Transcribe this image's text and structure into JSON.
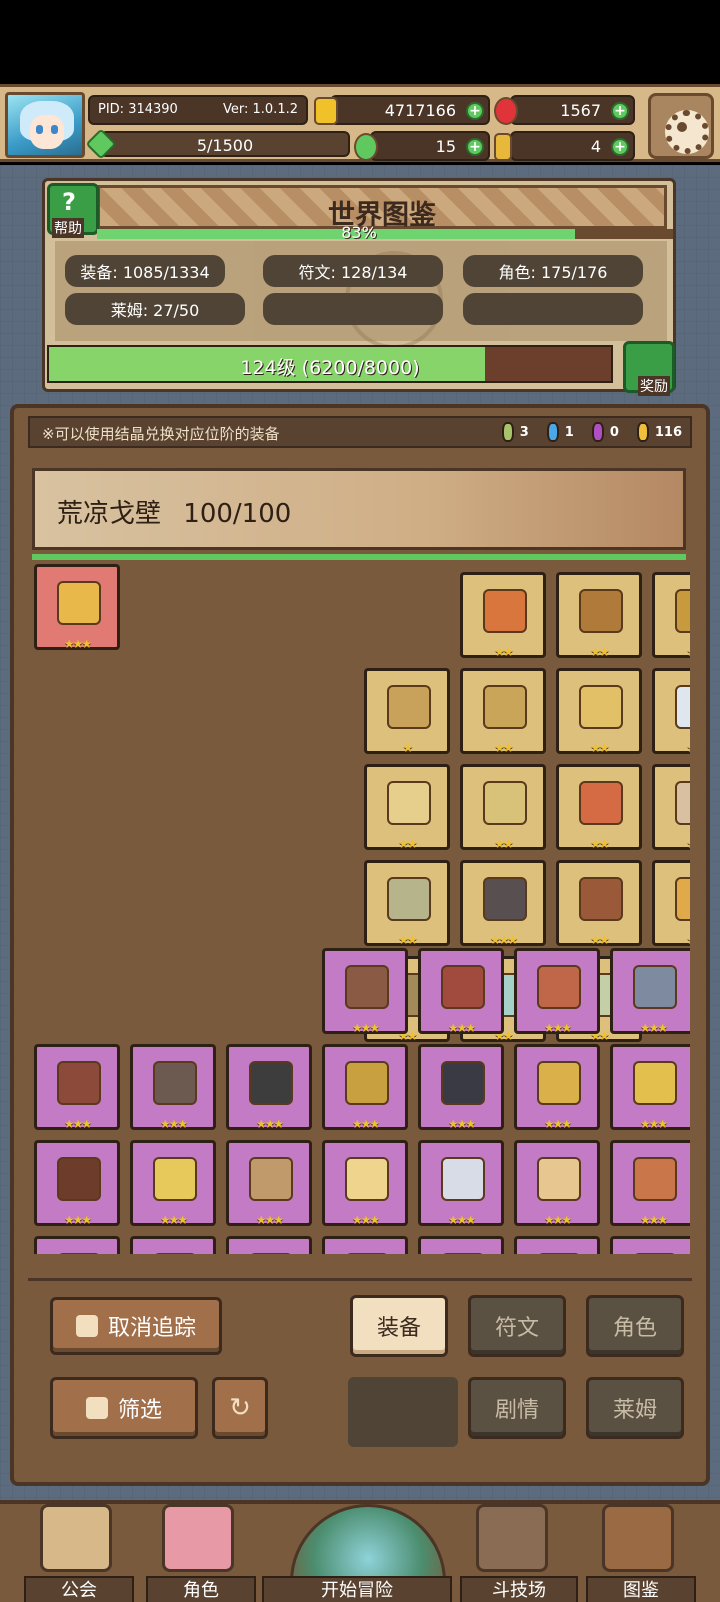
{
  "hud": {
    "pid": "PID: 314390",
    "version": "Ver: 1.0.1.2",
    "gold": "4717166",
    "gems": "1567",
    "xp": "5/1500",
    "clover": "15",
    "keys": "4"
  },
  "worldbook": {
    "title": "世界图鉴",
    "help_label": "帮助",
    "percent": "83%",
    "stats": [
      "装备: 1085/1334",
      "符文: 128/134",
      "角色: 175/176",
      "莱姆: 27/50"
    ],
    "level_text": "124级 (6200/8000)",
    "reward_label": "奖励"
  },
  "equipment": {
    "notice": "※可以使用结晶兑换对应位阶的装备",
    "crystals": [
      {
        "count": "3",
        "color": "#a8c36a"
      },
      {
        "count": "1",
        "color": "#4aa7e8"
      },
      {
        "count": "0",
        "color": "#b04fc1"
      },
      {
        "count": "116",
        "color": "#f0c03a"
      }
    ],
    "area_name": "荒凉戈壁",
    "area_progress": "100/100",
    "items": [
      {
        "bg": "red",
        "stars": "★★★",
        "color": "#e9b84a"
      },
      {
        "bg": "gold",
        "stars": "★★",
        "color": "#d9763e"
      },
      {
        "bg": "gold",
        "stars": "★★",
        "color": "#b07a3a"
      },
      {
        "bg": "gold",
        "stars": "★★",
        "color": "#c79a3e"
      },
      {
        "bg": "gold",
        "stars": "★★",
        "color": "#a9793c"
      },
      {
        "bg": "gold",
        "stars": "★★",
        "color": "#d6a546"
      },
      {
        "bg": "gold",
        "stars": "★★",
        "color": "#c0623f"
      },
      {
        "bg": "gold",
        "stars": "★",
        "color": "#c8a25a"
      },
      {
        "bg": "gold",
        "stars": "★★",
        "color": "#c9a55a"
      },
      {
        "bg": "gold",
        "stars": "★★",
        "color": "#e2c067"
      },
      {
        "bg": "gold",
        "stars": "★★",
        "color": "#dfe6ee"
      },
      {
        "bg": "gold",
        "stars": "★★",
        "color": "#8fd3e6"
      },
      {
        "bg": "gold",
        "stars": "★★",
        "color": "#c98f52"
      },
      {
        "bg": "gold",
        "stars": "★★",
        "color": "#9aa06a"
      },
      {
        "bg": "gold",
        "stars": "★★",
        "color": "#e6cf8c"
      },
      {
        "bg": "gold",
        "stars": "★★",
        "color": "#d8c27a"
      },
      {
        "bg": "gold",
        "stars": "★★",
        "color": "#d56b45"
      },
      {
        "bg": "gold",
        "stars": "★★",
        "color": "#d8c0a0"
      },
      {
        "bg": "gold",
        "stars": "★★",
        "color": "#b8474a"
      },
      {
        "bg": "gold",
        "stars": "★★",
        "color": "#7c9c82"
      },
      {
        "bg": "gold",
        "stars": "★★",
        "color": "#4e5744"
      },
      {
        "bg": "gold",
        "stars": "★★",
        "color": "#b6b48a"
      },
      {
        "bg": "gold",
        "stars": "★★★",
        "color": "#585050"
      },
      {
        "bg": "gold",
        "stars": "★★",
        "color": "#9a5a3a"
      },
      {
        "bg": "gold",
        "stars": "★★",
        "color": "#e0a94a"
      },
      {
        "bg": "gold",
        "stars": "★★",
        "color": "#c58a3e"
      },
      {
        "bg": "gold",
        "stars": "★★",
        "color": "#e06e3e"
      },
      {
        "bg": "gold",
        "stars": "★★",
        "color": "#d8843a"
      },
      {
        "bg": "gold",
        "stars": "★★",
        "color": "#a38a5a"
      },
      {
        "bg": "gold",
        "stars": "★★",
        "color": "#a6d1c8"
      },
      {
        "bg": "gold",
        "stars": "★★",
        "color": "#c4cfa8"
      },
      {
        "bg": "purple",
        "stars": "★★★",
        "color": "#8a5a44"
      },
      {
        "bg": "purple",
        "stars": "★★★",
        "color": "#a04b3e"
      },
      {
        "bg": "purple",
        "stars": "★★★",
        "color": "#c0674a"
      },
      {
        "bg": "purple",
        "stars": "★★★",
        "color": "#7d8aa0"
      },
      {
        "bg": "purple",
        "stars": "★★★",
        "color": "#8c4a3a"
      },
      {
        "bg": "purple",
        "stars": "★★★",
        "color": "#6c5a50"
      },
      {
        "bg": "purple",
        "stars": "★★★",
        "color": "#3d3d3d"
      },
      {
        "bg": "purple",
        "stars": "★★★",
        "color": "#c9a040"
      },
      {
        "bg": "purple",
        "stars": "★★★",
        "color": "#3a3a44"
      },
      {
        "bg": "purple",
        "stars": "★★★",
        "color": "#d9b04a"
      },
      {
        "bg": "purple",
        "stars": "★★★",
        "color": "#e3c04e"
      },
      {
        "bg": "purple",
        "stars": "★★★",
        "color": "#6e3c2a"
      },
      {
        "bg": "purple",
        "stars": "★★★",
        "color": "#e7c85a"
      },
      {
        "bg": "purple",
        "stars": "★★★",
        "color": "#c09a6a"
      },
      {
        "bg": "purple",
        "stars": "★★★",
        "color": "#eed48c"
      },
      {
        "bg": "purple",
        "stars": "★★★",
        "color": "#d8dce6"
      },
      {
        "bg": "purple",
        "stars": "★★★",
        "color": "#e8c690"
      },
      {
        "bg": "purple",
        "stars": "★★★",
        "color": "#c9774a"
      },
      {
        "bg": "purple",
        "stars": "★★★",
        "color": "#d8744a"
      },
      {
        "bg": "purple",
        "stars": "★★★",
        "color": "#6a4a2e"
      },
      {
        "bg": "purple",
        "stars": "★★★",
        "color": "#d2a34a"
      },
      {
        "bg": "purple",
        "stars": "★★★",
        "color": "#c8a060"
      },
      {
        "bg": "purple",
        "stars": "★★★",
        "color": "#9a6c3a"
      },
      {
        "bg": "purple",
        "stars": "★★★",
        "color": "#4a3a34"
      },
      {
        "bg": "purple",
        "stars": "★★★",
        "color": "#d6a040"
      },
      {
        "bg": "purple",
        "stars": "★★★",
        "color": "#e0b070"
      }
    ]
  },
  "controls": {
    "untrack": "取消追踪",
    "filter": "筛选",
    "tab_equipment": "装备",
    "tab_rune": "符文",
    "tab_character": "角色",
    "tab_story": "剧情",
    "tab_slime": "莱姆"
  },
  "nav": {
    "guild": "公会",
    "character": "角色",
    "adventure": "开始冒险",
    "arena": "斗技场",
    "codex": "图鉴"
  }
}
